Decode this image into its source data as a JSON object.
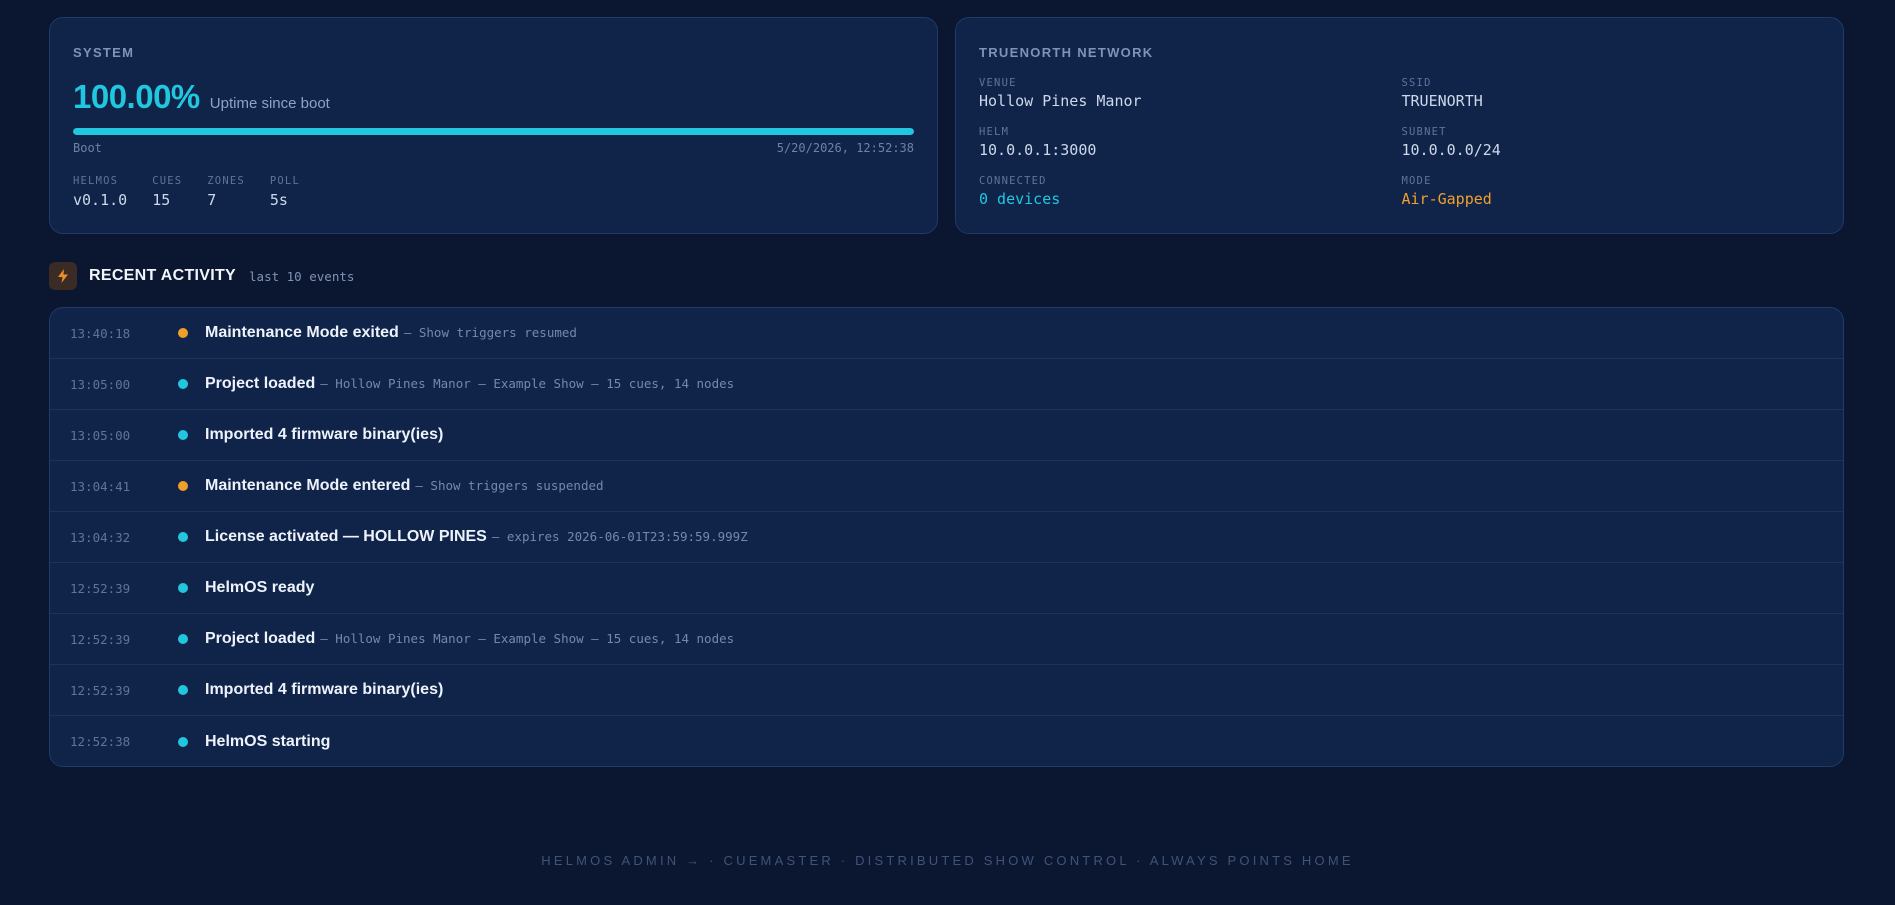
{
  "system": {
    "title": "SYSTEM",
    "uptime_value": "100.00%",
    "uptime_label": "Uptime since boot",
    "uptime_fraction": 1.0,
    "boot_label": "Boot",
    "boot_time": "5/20/2026, 12:52:38",
    "stats": [
      {
        "key": "HELMOS",
        "value": "v0.1.0"
      },
      {
        "key": "CUES",
        "value": "15"
      },
      {
        "key": "ZONES",
        "value": "7"
      },
      {
        "key": "POLL",
        "value": "5s"
      }
    ]
  },
  "network": {
    "title": "TRUENORTH NETWORK",
    "venue_key": "VENUE",
    "venue": "Hollow Pines Manor",
    "ssid_key": "SSID",
    "ssid": "TRUENORTH",
    "helm_key": "HELM",
    "helm": "10.0.0.1:3000",
    "subnet_key": "SUBNET",
    "subnet": "10.0.0.0/24",
    "connected_key": "CONNECTED",
    "connected": "0 devices",
    "mode_key": "MODE",
    "mode": "Air-Gapped"
  },
  "activity": {
    "title": "RECENT ACTIVITY",
    "subtitle": "last 10 events",
    "icon": "bolt-icon",
    "events": [
      {
        "time": "13:40:18",
        "status": "warning",
        "title": "Maintenance Mode exited",
        "detail": "— Show triggers resumed"
      },
      {
        "time": "13:05:00",
        "status": "info",
        "title": "Project loaded",
        "detail": "— Hollow Pines Manor — Example Show — 15 cues, 14 nodes"
      },
      {
        "time": "13:05:00",
        "status": "info",
        "title": "Imported 4 firmware binary(ies)",
        "detail": ""
      },
      {
        "time": "13:04:41",
        "status": "warning",
        "title": "Maintenance Mode entered",
        "detail": "— Show triggers suspended"
      },
      {
        "time": "13:04:32",
        "status": "info",
        "title": "License activated — HOLLOW PINES",
        "detail": "— expires 2026-06-01T23:59:59.999Z"
      },
      {
        "time": "12:52:39",
        "status": "info",
        "title": "HelmOS ready",
        "detail": ""
      },
      {
        "time": "12:52:39",
        "status": "info",
        "title": "Project loaded",
        "detail": "— Hollow Pines Manor — Example Show — 15 cues, 14 nodes"
      },
      {
        "time": "12:52:39",
        "status": "info",
        "title": "Imported 4 firmware binary(ies)",
        "detail": ""
      },
      {
        "time": "12:52:38",
        "status": "info",
        "title": "HelmOS starting",
        "detail": ""
      }
    ]
  },
  "colors": {
    "info": "#21c7de",
    "warning": "#f0a02a"
  },
  "footer": "HELMOS ADMIN → · CUEMASTER · DISTRIBUTED SHOW CONTROL · ALWAYS POINTS HOME"
}
